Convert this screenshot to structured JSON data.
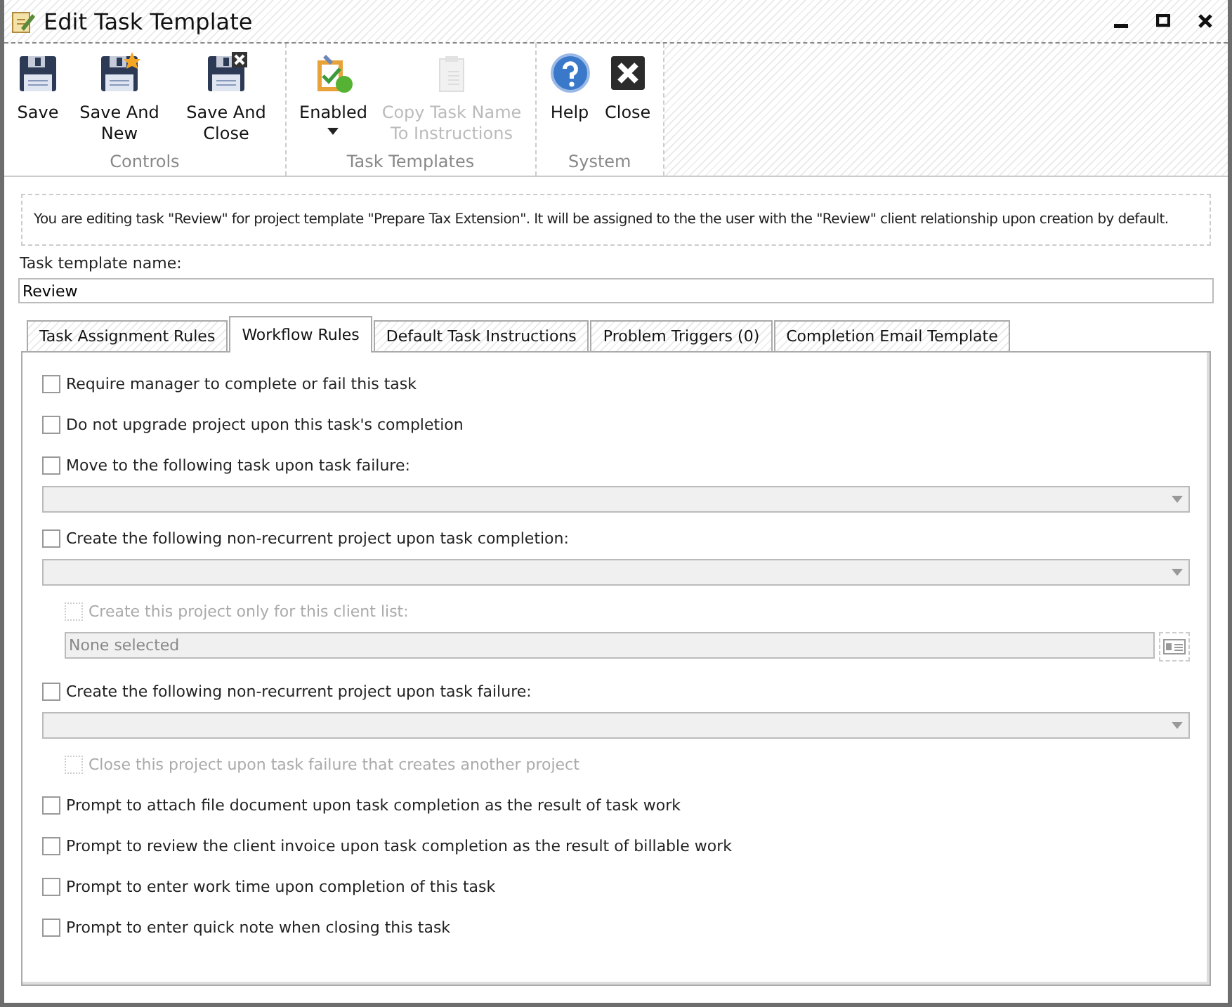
{
  "window": {
    "title": "Edit Task Template"
  },
  "ribbon": {
    "groups": [
      {
        "label": "Controls",
        "buttons": [
          {
            "label": "Save",
            "disabled": false
          },
          {
            "label": "Save And New",
            "disabled": false
          },
          {
            "label": "Save And Close",
            "disabled": false
          }
        ]
      },
      {
        "label": "Task Templates",
        "buttons": [
          {
            "label": "Enabled",
            "disabled": false,
            "dropdown": true
          },
          {
            "label": "Copy Task Name To Instructions",
            "disabled": true
          }
        ]
      },
      {
        "label": "System",
        "buttons": [
          {
            "label": "Help",
            "disabled": false
          },
          {
            "label": "Close",
            "disabled": false
          }
        ]
      }
    ]
  },
  "info": "You are editing task \"Review\" for project template \"Prepare Tax Extension\". It will be assigned to the the user with the \"Review\" client relationship upon creation by default.",
  "name_field": {
    "label": "Task template name:",
    "value": "Review"
  },
  "tabs": [
    {
      "label": "Task Assignment Rules",
      "selected": false
    },
    {
      "label": "Workflow Rules",
      "selected": true
    },
    {
      "label": "Default Task Instructions",
      "selected": false
    },
    {
      "label": "Problem Triggers (0)",
      "selected": false
    },
    {
      "label": "Completion Email Template",
      "selected": false
    }
  ],
  "rules": [
    {
      "kind": "checkbox",
      "label": "Require manager to complete or fail this task",
      "checked": false,
      "disabled": false
    },
    {
      "kind": "checkbox",
      "label": "Do not upgrade project upon this task's completion",
      "checked": false,
      "disabled": false
    },
    {
      "kind": "checkbox",
      "label": "Move to the following task upon task failure:",
      "checked": false,
      "disabled": false
    },
    {
      "kind": "dropdown",
      "disabled": true
    },
    {
      "kind": "checkbox",
      "label": "Create the following non-recurrent project upon task completion:",
      "checked": false,
      "disabled": false
    },
    {
      "kind": "dropdown",
      "disabled": true
    },
    {
      "kind": "sub_checkbox",
      "label": "Create this project only for this client list:",
      "checked": false,
      "disabled": true
    },
    {
      "kind": "client_list",
      "value": "None selected",
      "disabled": true
    },
    {
      "kind": "checkbox",
      "label": "Create the following non-recurrent project upon task failure:",
      "checked": false,
      "disabled": false
    },
    {
      "kind": "dropdown",
      "disabled": true
    },
    {
      "kind": "sub_checkbox",
      "label": "Close this project upon task failure that creates another project",
      "checked": false,
      "disabled": true
    },
    {
      "kind": "checkbox",
      "label": "Prompt to attach file document upon task completion as the result of task work",
      "checked": false,
      "disabled": false
    },
    {
      "kind": "checkbox",
      "label": "Prompt to review the client invoice upon task completion as the result of billable work",
      "checked": false,
      "disabled": false
    },
    {
      "kind": "checkbox",
      "label": "Prompt to enter work time upon completion of this task",
      "checked": false,
      "disabled": false
    },
    {
      "kind": "checkbox",
      "label": "Prompt to enter quick note when closing this task",
      "checked": false,
      "disabled": false
    }
  ]
}
